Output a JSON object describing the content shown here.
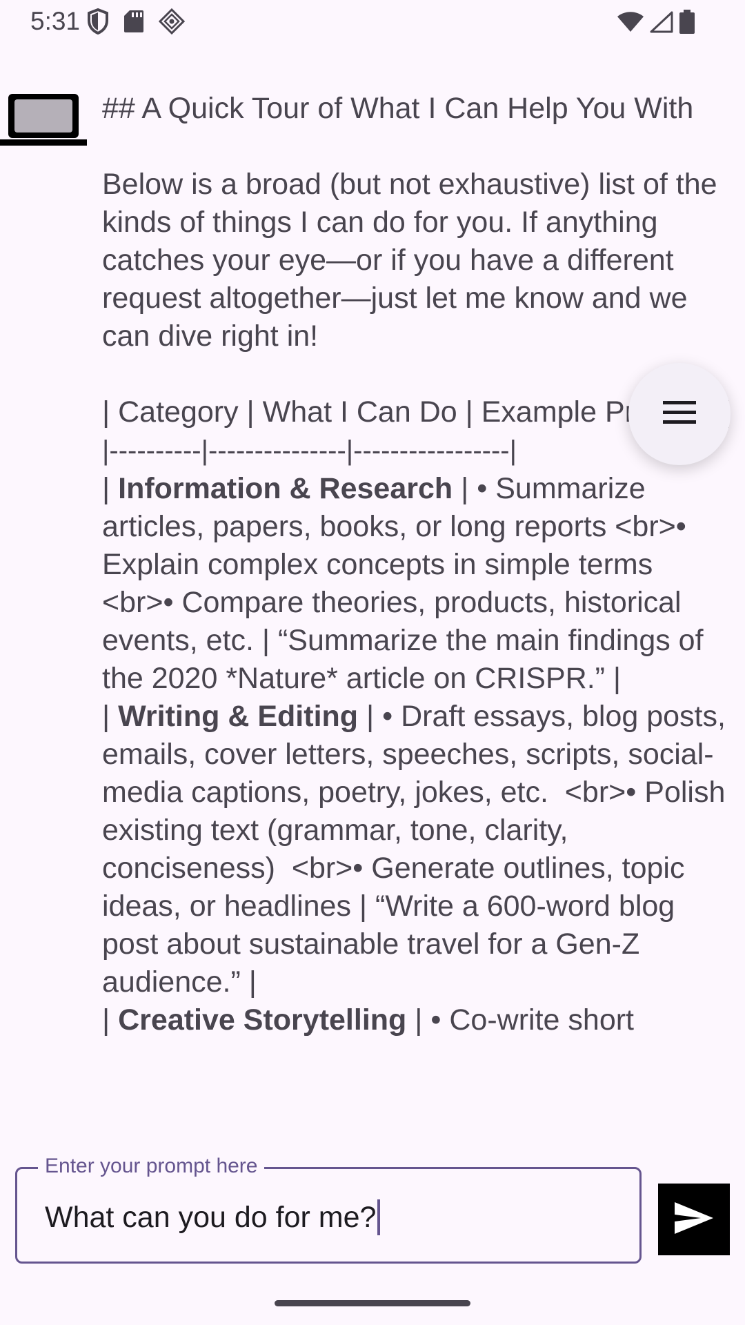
{
  "status_bar": {
    "time": "5:31",
    "left_icons": [
      "shield-icon",
      "sd-card-icon",
      "network-diamond-icon"
    ],
    "right_icons": [
      "wifi-icon",
      "cellular-signal-icon",
      "battery-icon"
    ]
  },
  "message": {
    "avatar_icon": "laptop-icon",
    "heading_line": "## A Quick Tour of What I Can Help You With",
    "intro": "Below is a broad (but not exhaustive) list of the kinds of things I can do for you. If anything catches your eye—or if you have a different request altogether—just let me know and we can dive right in!",
    "table_header": "| Category | What I Can Do | Example Prompts |",
    "table_separator": "|----------|---------------|-----------------|",
    "rows": [
      {
        "category": "Information & Research",
        "body": " | • Summarize articles, papers, books, or long reports <br>• Explain complex concepts in simple terms  <br>• Compare theories, products, historical events, etc. | “Summarize the main findings of the 2020 *Nature* article on CRISPR.” |"
      },
      {
        "category": "Writing & Editing",
        "body": " | • Draft essays, blog posts, emails, cover letters, speeches, scripts, social-media captions, poetry, jokes, etc.  <br>• Polish existing text (grammar, tone, clarity, conciseness)  <br>• Generate outlines, topic ideas, or headlines | “Write a 600-word blog post about sustainable travel for a Gen-Z audience.” |"
      },
      {
        "category": "Creative Storytelling",
        "body": " | • Co-write short"
      }
    ]
  },
  "fab": {
    "icon": "menu-icon"
  },
  "prompt": {
    "label": "Enter your prompt here",
    "value": "What can you do for me?"
  },
  "send": {
    "icon": "send-icon"
  },
  "colors": {
    "background": "#fdf7fe",
    "accent": "#65558f",
    "text": "#49454f"
  }
}
